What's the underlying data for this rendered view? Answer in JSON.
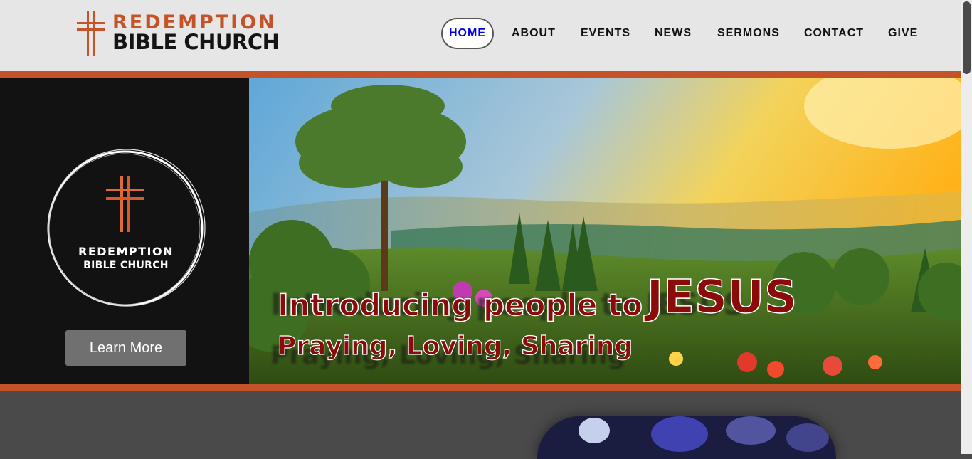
{
  "logo": {
    "line1": "REDEMPTION",
    "line2": "BIBLE CHURCH",
    "icon": "cross-icon"
  },
  "nav": {
    "items": [
      {
        "label": "HOME",
        "active": true
      },
      {
        "label": "ABOUT"
      },
      {
        "label": "EVENTS"
      },
      {
        "label": "NEWS"
      },
      {
        "label": "SERMONS"
      },
      {
        "label": "CONTACT"
      },
      {
        "label": "GIVE"
      }
    ]
  },
  "sidebar": {
    "badge_line1": "REDEMPTION",
    "badge_line2": "BIBLE CHURCH",
    "button_label": "Learn More"
  },
  "hero": {
    "headline_prefix": "Introducing people to",
    "headline_emphasis": "JESUS",
    "subheadline": "Praying, Loving, Sharing"
  },
  "colors": {
    "accent": "#c4532a",
    "header_bg": "#e6e6e6",
    "headline": "#8b0a0a",
    "active_nav_text": "#0000e0",
    "button_bg": "#707070"
  }
}
